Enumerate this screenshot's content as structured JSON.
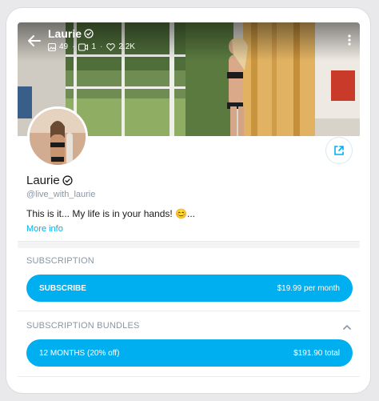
{
  "cover": {
    "name": "Laurie",
    "photos_count": "49",
    "videos_count": "1",
    "likes_count": "2.2K"
  },
  "profile": {
    "name": "Laurie",
    "handle": "@live_with_laurie",
    "bio": "This is it... My life is in your hands! 😊...",
    "more_info": "More info"
  },
  "subscription": {
    "title": "SUBSCRIPTION",
    "button_label": "SUBSCRIBE",
    "button_price": "$19.99 per month"
  },
  "bundles": {
    "title": "SUBSCRIPTION BUNDLES",
    "items": [
      {
        "label": "12 MONTHS (20% off)",
        "price": "$191.90 total"
      }
    ]
  },
  "colors": {
    "accent": "#00aff0",
    "muted": "#8a96a3"
  }
}
